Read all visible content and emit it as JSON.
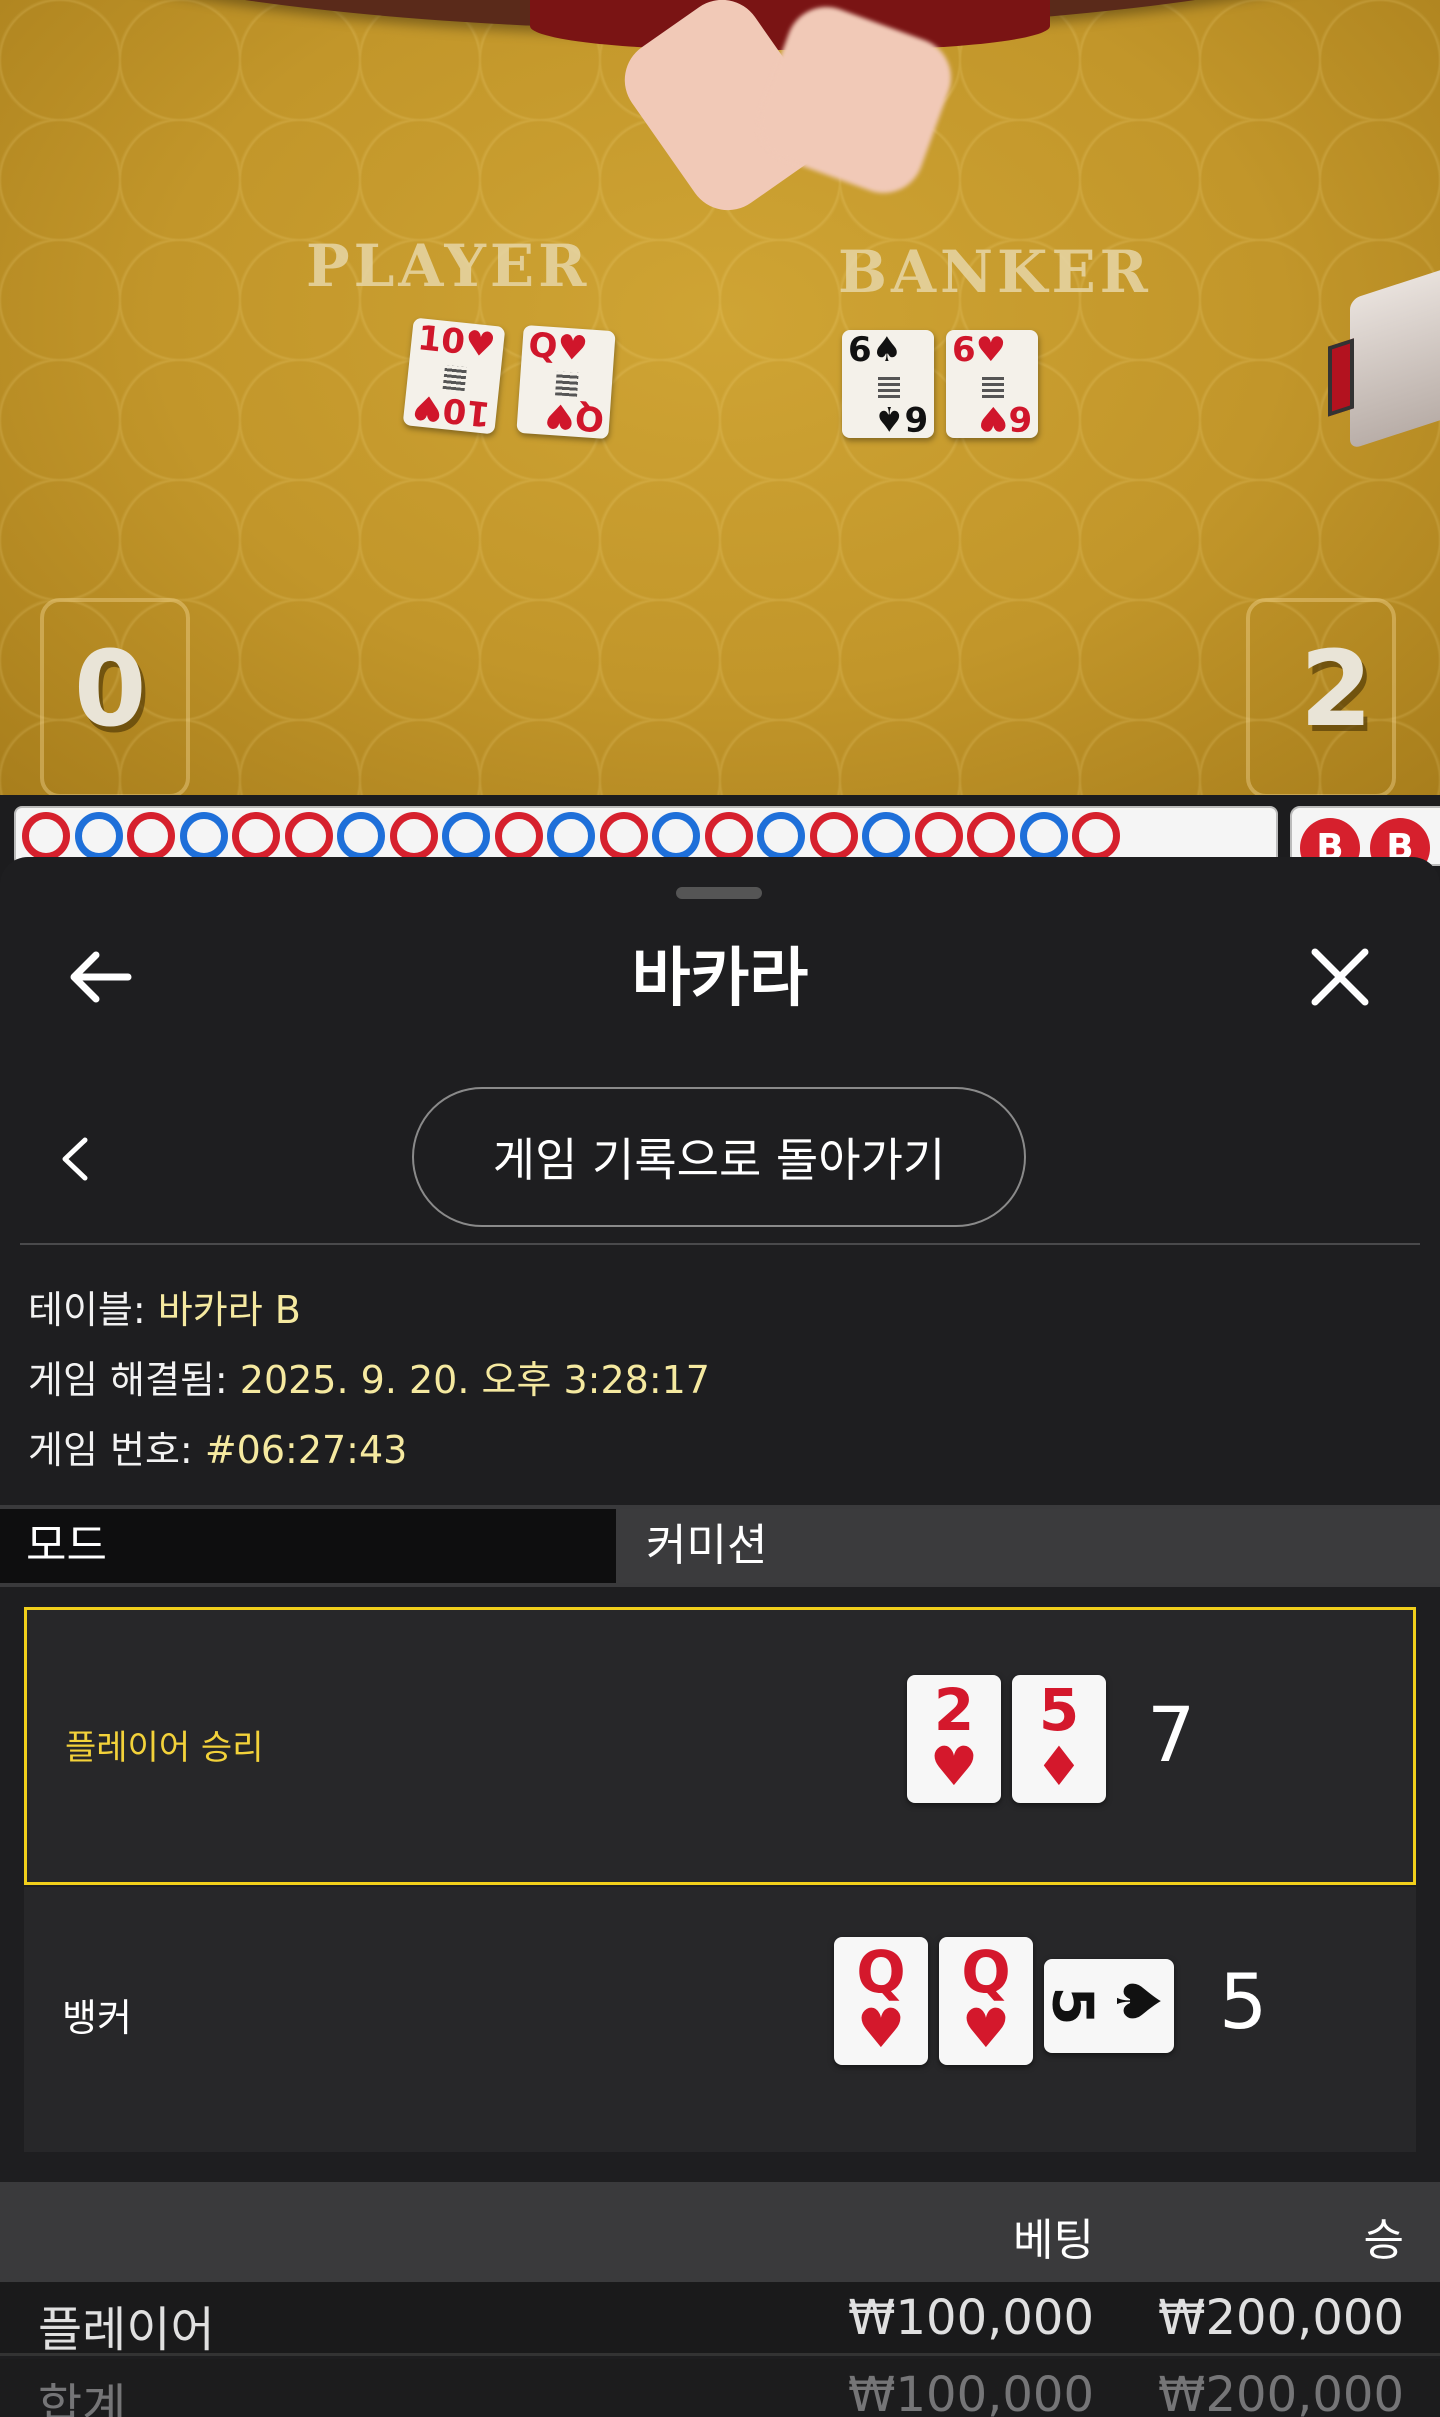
{
  "video": {
    "player_label": "PLAYER",
    "banker_label": "BANKER",
    "player_cards": [
      {
        "rank": "10",
        "suit": "♥",
        "color": "red"
      },
      {
        "rank": "Q",
        "suit": "♥",
        "color": "red"
      }
    ],
    "banker_cards": [
      {
        "rank": "6",
        "suit": "♠",
        "color": "black"
      },
      {
        "rank": "6",
        "suit": "♥",
        "color": "red"
      }
    ],
    "player_score": "0",
    "banker_score": "2"
  },
  "roadmap": {
    "beads": [
      "b",
      "p",
      "b",
      "p",
      "b",
      "b",
      "p",
      "b",
      "p",
      "b",
      "p",
      "b",
      "p",
      "b",
      "p",
      "b",
      "p",
      "b",
      "b",
      "p",
      "b"
    ],
    "right_pill_1": "B",
    "right_pill_2": "B"
  },
  "sheet": {
    "title": "바카라",
    "return_button": "게임 기록으로 돌아가기",
    "table_label": "테이블:",
    "table_value": "바카라 B",
    "resolved_label": "게임 해결됨:",
    "resolved_value": "2025. 9. 20. 오후 3:28:17",
    "game_no_label": "게임 번호:",
    "game_no_value": "#06:27:43",
    "mode_label": "모드",
    "mode_value": "커미션"
  },
  "results": {
    "player": {
      "label": "플레이어 승리",
      "cards": [
        {
          "rank": "2",
          "suit": "♥"
        },
        {
          "rank": "5",
          "suit": "♦"
        }
      ],
      "points": "7"
    },
    "banker": {
      "label": "뱅커",
      "cards": [
        {
          "rank": "Q",
          "suit": "♥"
        },
        {
          "rank": "Q",
          "suit": "♥"
        },
        {
          "rank": "5",
          "suit": "♠",
          "sideways": true
        }
      ],
      "points": "5"
    }
  },
  "bets": {
    "header_bet": "베팅",
    "header_win": "승",
    "rows": [
      {
        "name": "플레이어",
        "bet": "₩100,000",
        "win": "₩200,000"
      },
      {
        "name": "합계",
        "bet": "₩100,000",
        "win": "₩200,000"
      }
    ]
  },
  "colors": {
    "accent_yellow": "#f1cf1b",
    "player_blue": "#1e6fd9",
    "banker_red": "#d6202d",
    "felt": "#c2962a"
  }
}
